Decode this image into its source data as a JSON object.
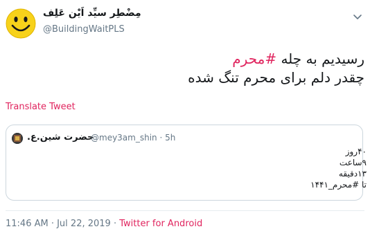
{
  "author": {
    "name": "مِضْطِر سیِّد اَیْن عَلِف",
    "handle": "@BuildingWaitPLS",
    "avatar": "smiley-face-avatar"
  },
  "tweet": {
    "line1_prefix": "رسیدیم به چله ",
    "line1_hashtag": "#محرم",
    "line2": "چقدر دلم برای محرم تنگ شده"
  },
  "translate_label": "Translate Tweet",
  "quoted_tweet": {
    "name": "حضرت شین.ع.",
    "handle": "@mey3am_shin",
    "separator": " · ",
    "time": "5h",
    "lines": [
      "۴۰روز",
      "۹ساعت",
      "۱۳دقیقه",
      "تا #محرم_۱۴۴۱"
    ]
  },
  "footer": {
    "time": "11:46 AM · Jul 22, 2019 · ",
    "source": "Twitter for Android"
  },
  "colors": {
    "accent": "#e0245e",
    "secondary_text": "#657786",
    "border": "#ccd6dd"
  },
  "icons": {
    "menu": "chevron-down-icon"
  }
}
